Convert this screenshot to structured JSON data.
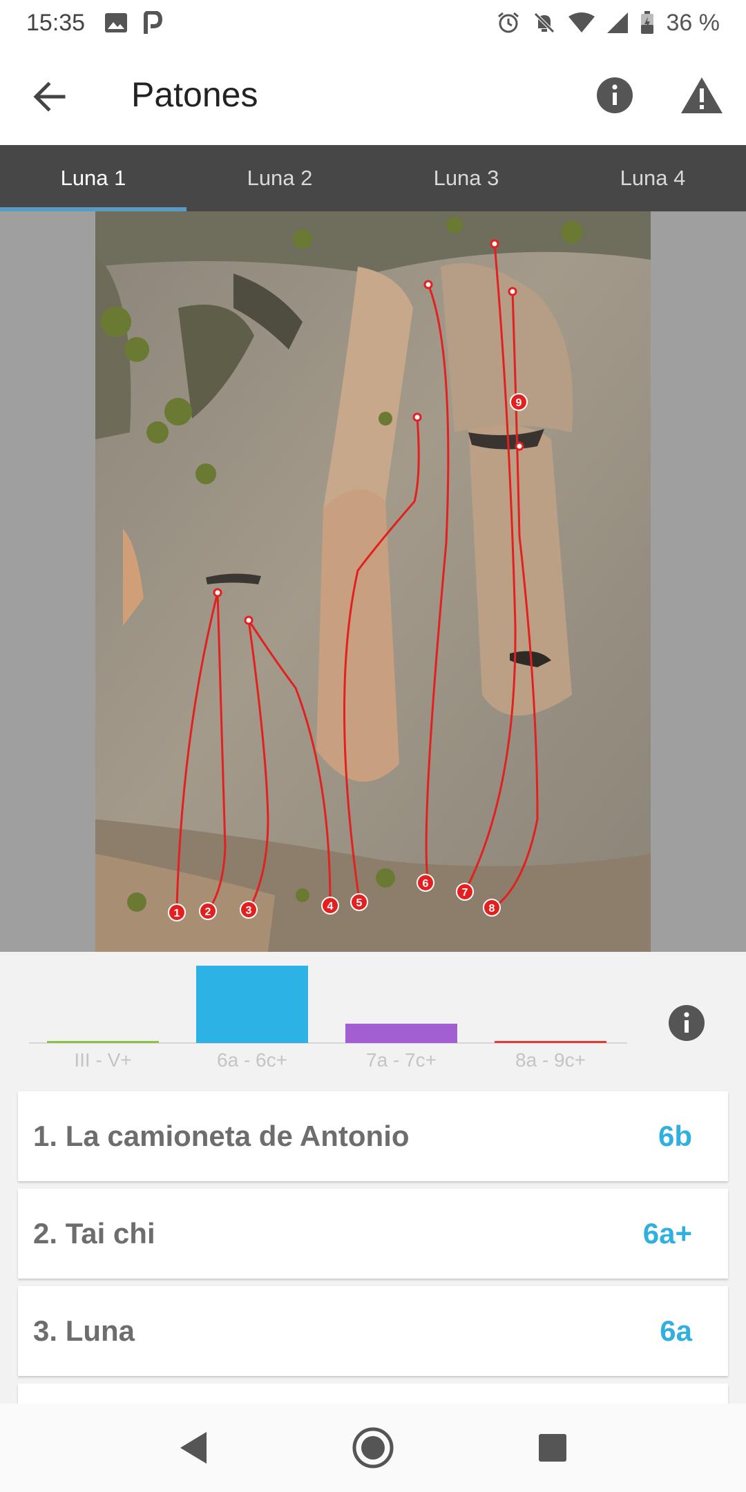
{
  "status_bar": {
    "time": "15:35",
    "battery": "36 %",
    "icons": [
      "image-icon",
      "parking-icon",
      "alarm-icon",
      "silent-icon",
      "wifi-icon",
      "signal-icon",
      "battery-icon"
    ]
  },
  "toolbar": {
    "title": "Patones",
    "back_icon": "arrow-back-icon",
    "info_icon": "info-icon",
    "warning_icon": "warning-icon"
  },
  "tabs": [
    {
      "label": "Luna 1",
      "active": true
    },
    {
      "label": "Luna 2",
      "active": false
    },
    {
      "label": "Luna 3",
      "active": false
    },
    {
      "label": "Luna 4",
      "active": false
    }
  ],
  "topo": {
    "route_numbers": [
      "1",
      "2",
      "3",
      "4",
      "5",
      "6",
      "7",
      "8",
      "9"
    ],
    "line_color": "#e41f1f"
  },
  "chart_data": {
    "type": "bar",
    "categories": [
      "III - V+",
      "6a - 6c+",
      "7a - 7c+",
      "8a - 9c+"
    ],
    "values": [
      0,
      6,
      1.5,
      0
    ],
    "colors": [
      "#8bc34a",
      "#2db2e6",
      "#a35fd1",
      "#e53935"
    ],
    "title": "",
    "xlabel": "",
    "ylabel": ""
  },
  "chart_info_icon": "info-icon",
  "routes": [
    {
      "name": "1. La camioneta de Antonio",
      "grade": "6b"
    },
    {
      "name": "2. Tai chi",
      "grade": "6a+"
    },
    {
      "name": "3. Luna",
      "grade": "6a"
    }
  ],
  "grade_color": "#2fb0e0",
  "nav": [
    "back-triangle-icon",
    "home-circle-icon",
    "recents-square-icon"
  ]
}
